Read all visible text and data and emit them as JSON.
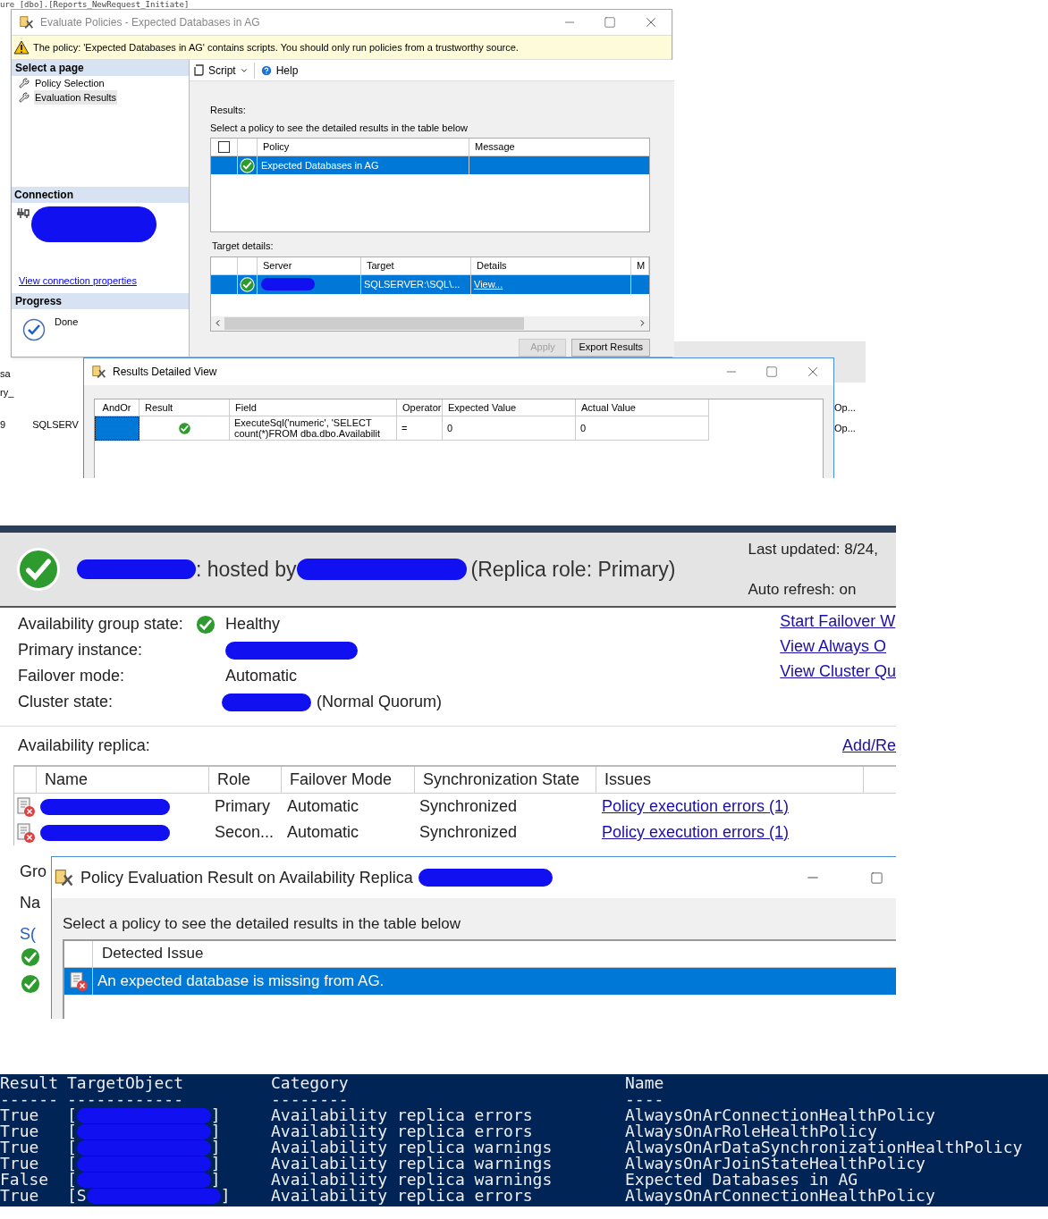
{
  "code_fragment": "ure [dbo].[Reports_NewRequest_Initiate]",
  "evaluate_window": {
    "title": "Evaluate Policies - Expected Databases in AG",
    "warning": "The policy: 'Expected Databases in AG' contains scripts. You should only run policies from a trustworthy source.",
    "select_page": {
      "heading": "Select a page",
      "items": [
        {
          "label": "Policy Selection",
          "selected": false
        },
        {
          "label": "Evaluation Results",
          "selected": true
        }
      ]
    },
    "connection": {
      "heading": "Connection",
      "link": "View connection properties"
    },
    "progress": {
      "heading": "Progress",
      "status": "Done"
    },
    "toolbar": [
      {
        "label": "Script",
        "kind": "dropdown"
      },
      {
        "label": "Help",
        "kind": "help"
      }
    ],
    "results_label": "Results:",
    "results_hint": "Select a policy to see the detailed results in the table below",
    "policy_table": {
      "header_checked": false,
      "columns": [
        "Policy",
        "Message"
      ],
      "rows": [
        {
          "policy": "Expected Databases in AG",
          "selected": true
        }
      ]
    },
    "target_label": "Target details:",
    "target_table": {
      "columns": [
        "Server",
        "Target",
        "Details",
        "M"
      ],
      "rows": [
        {
          "target": "SQLSERVER:\\SQL\\...",
          "details": "View...",
          "selected": true
        }
      ]
    },
    "buttons": [
      {
        "label": "Apply",
        "disabled": true
      },
      {
        "label": "Export Results",
        "disabled": false
      }
    ]
  },
  "background_cells": {
    "left": [
      "sa",
      "ry_"
    ],
    "row": [
      "9",
      "SQLSERV"
    ],
    "right": [
      "Op...",
      "Op..."
    ]
  },
  "detail_window": {
    "title": "Results Detailed View",
    "columns": [
      "AndOr",
      "Result",
      "Field",
      "Operator",
      "Expected Value",
      "Actual Value"
    ],
    "rows": [
      {
        "field": "ExecuteSql('numeric', 'SELECT count(*)FROM dba.dbo.Availabilit",
        "operator": "=",
        "expected": "0",
        "actual": "0",
        "selected": true
      }
    ]
  },
  "dashboard": {
    "hosted_by": ": hosted by",
    "role": "(Replica role: Primary)",
    "last_updated": "Last updated: 8/24,",
    "auto_refresh": "Auto refresh: on",
    "fields": [
      {
        "label": "Availability group state:",
        "kind": "status",
        "value": "Healthy"
      },
      {
        "label": "Primary instance:",
        "kind": "redacted"
      },
      {
        "label": "Failover mode:",
        "kind": "text",
        "value": "Automatic"
      },
      {
        "label": "Cluster state:",
        "kind": "redacted_suffix",
        "value": "(Normal Quorum)"
      }
    ],
    "links": [
      "Start Failover W",
      "View Always O",
      "View Cluster Qu"
    ],
    "replica_label": "Availability replica:",
    "replica_link": "Add/Re",
    "replica_columns": [
      "Name",
      "Role",
      "Failover Mode",
      "Synchronization State",
      "Issues"
    ],
    "replicas": [
      {
        "role": "Primary",
        "failover": "Automatic",
        "sync": "Synchronized",
        "issues": "Policy execution errors (1)"
      },
      {
        "role": "Secon...",
        "failover": "Automatic",
        "sync": "Synchronized",
        "issues": "Policy execution errors (1)"
      }
    ],
    "background_labels": [
      "Gro",
      "Na",
      "S("
    ]
  },
  "policy_window": {
    "title": "Policy Evaluation Result on Availability Replica",
    "hint": "Select a policy to see the detailed results in the table below",
    "column": "Detected Issue",
    "rows": [
      {
        "issue": "An expected database is missing from AG.",
        "selected": true
      }
    ]
  },
  "powershell": {
    "columns": [
      "Result",
      "TargetObject",
      "Category",
      "Name"
    ],
    "underlines": [
      "------",
      "------------",
      "--------",
      "----"
    ],
    "rows": [
      {
        "result": "True",
        "open": "[",
        "close": "]",
        "category": "Availability replica errors",
        "name": "AlwaysOnArConnectionHealthPolicy"
      },
      {
        "result": "True",
        "open": "[",
        "close": "]",
        "category": "Availability replica errors",
        "name": "AlwaysOnArRoleHealthPolicy"
      },
      {
        "result": "True",
        "open": "[",
        "close": "]",
        "category": "Availability replica warnings",
        "name": "AlwaysOnArDataSynchronizationHealthPolicy"
      },
      {
        "result": "True",
        "open": "[",
        "close": "]",
        "category": "Availability replica warnings",
        "name": "AlwaysOnArJoinStateHealthPolicy"
      },
      {
        "result": "False",
        "open": "[",
        "close": "]",
        "category": "Availability replica warnings",
        "name": "Expected Databases in AG"
      },
      {
        "result": "True",
        "open": "[S",
        "close": "]",
        "category": "Availability replica errors",
        "name": "AlwaysOnArConnectionHealthPolicy"
      }
    ]
  }
}
